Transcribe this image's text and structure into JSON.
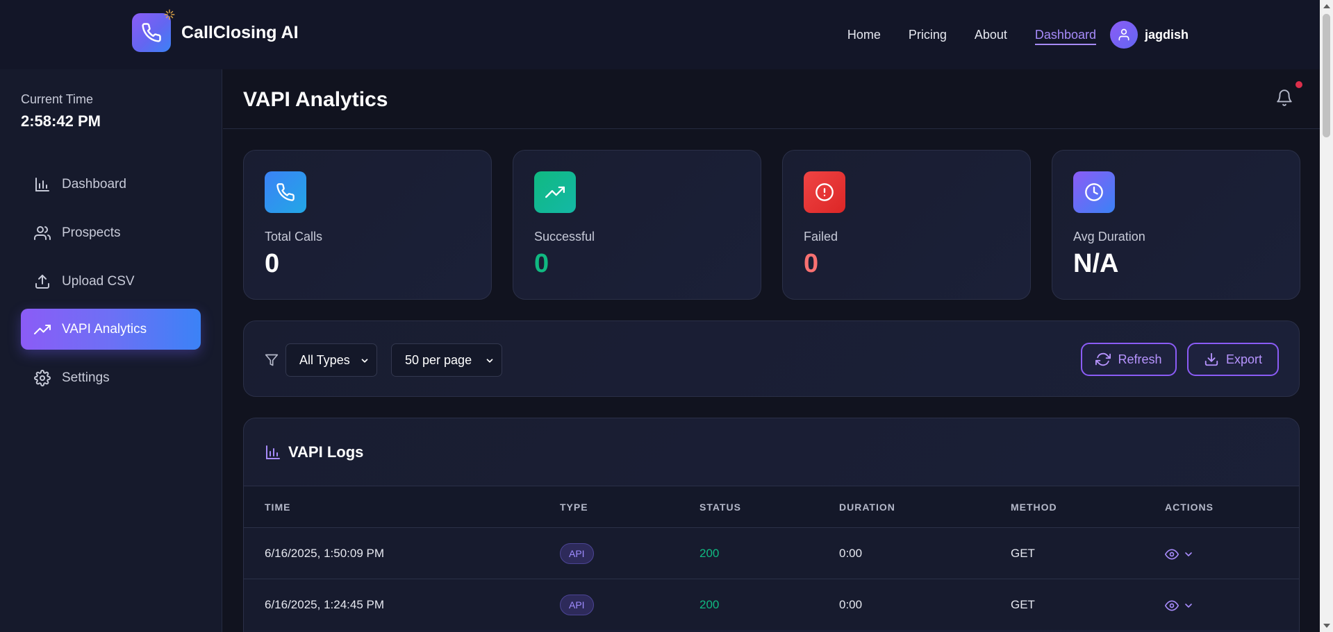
{
  "app": {
    "name": "CallClosing AI"
  },
  "nav": {
    "links": [
      "Home",
      "Pricing",
      "About",
      "Dashboard"
    ],
    "active": "Dashboard",
    "user_name": "jagdish"
  },
  "sidebar": {
    "time_label": "Current Time",
    "time_value": "2:58:42 PM",
    "items": [
      {
        "label": "Dashboard",
        "icon": "bar-chart-icon"
      },
      {
        "label": "Prospects",
        "icon": "users-icon"
      },
      {
        "label": "Upload CSV",
        "icon": "upload-icon"
      },
      {
        "label": "VAPI Analytics",
        "icon": "trending-up-icon",
        "active": true
      },
      {
        "label": "Settings",
        "icon": "gear-icon"
      }
    ]
  },
  "page": {
    "title": "VAPI Analytics"
  },
  "stats": [
    {
      "label": "Total Calls",
      "value": "0",
      "icon": "phone-icon",
      "color": "#ffffff"
    },
    {
      "label": "Successful",
      "value": "0",
      "icon": "trending-up-icon",
      "color": "#10b981"
    },
    {
      "label": "Failed",
      "value": "0",
      "icon": "alert-circle-icon",
      "color": "#f87171"
    },
    {
      "label": "Avg Duration",
      "value": "N/A",
      "icon": "clock-icon",
      "color": "#ffffff"
    }
  ],
  "filters": {
    "type_selected": "All Types",
    "per_page_selected": "50 per page",
    "refresh_label": "Refresh",
    "export_label": "Export"
  },
  "logs": {
    "title": "VAPI Logs",
    "columns": [
      "TIME",
      "TYPE",
      "STATUS",
      "DURATION",
      "METHOD",
      "ACTIONS"
    ],
    "rows": [
      {
        "time": "6/16/2025, 1:50:09 PM",
        "type": "API",
        "status": "200",
        "duration": "0:00",
        "method": "GET"
      },
      {
        "time": "6/16/2025, 1:24:45 PM",
        "type": "API",
        "status": "200",
        "duration": "0:00",
        "method": "GET"
      }
    ]
  },
  "colors": {
    "accent": "#8b5cf6",
    "accent_blue": "#3b82f6",
    "success": "#10b981",
    "danger": "#f87171",
    "background": "#11131f"
  }
}
